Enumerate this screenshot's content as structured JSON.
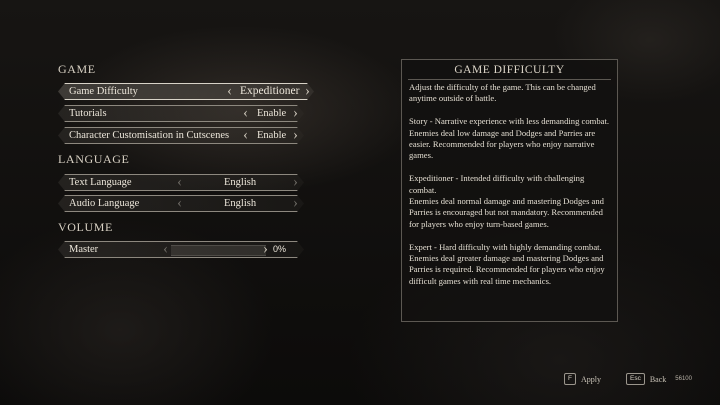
{
  "sections": {
    "game": "GAME",
    "language": "LANGUAGE",
    "volume": "VOLUME"
  },
  "settings": [
    {
      "label": "Game Difficulty",
      "value": "Expeditioner"
    },
    {
      "label": "Tutorials",
      "value": "Enable"
    },
    {
      "label": "Character Customisation in Cutscenes",
      "value": "Enable"
    },
    {
      "label": "Text Language",
      "value": "English"
    },
    {
      "label": "Audio Language",
      "value": "English"
    },
    {
      "label": "Master",
      "value": "0%"
    }
  ],
  "volume_level": 0,
  "icons": {
    "prev": "chevron-left-icon",
    "next": "chevron-right-icon"
  },
  "colors": {
    "background": "#0d0c0b",
    "text": "#ece6da",
    "border": "#8d887f"
  },
  "panel": {
    "title": "GAME DIFFICULTY",
    "intro": "Adjust the difficulty of the game. This can be changed anytime outside of battle.",
    "story": "Story - Narrative experience with less demanding combat.\nEnemies deal low damage and Dodges and Parries are easier. Recommended for players who enjoy narrative games.",
    "expeditioner": "Expeditioner - Intended difficulty with challenging combat.\nEnemies deal normal damage and mastering Dodges and Parries is encouraged but not mandatory. Recommended for players who enjoy turn-based games.",
    "expert": "Expert - Hard difficulty with highly demanding combat.\nEnemies deal greater damage and mastering Dodges and Parries is required. Recommended for players who enjoy difficult games with real time mechanics."
  },
  "footer": {
    "apply_key": "F",
    "apply_label": "Apply",
    "back_key": "Esc",
    "back_label": "Back",
    "code": "56100"
  }
}
